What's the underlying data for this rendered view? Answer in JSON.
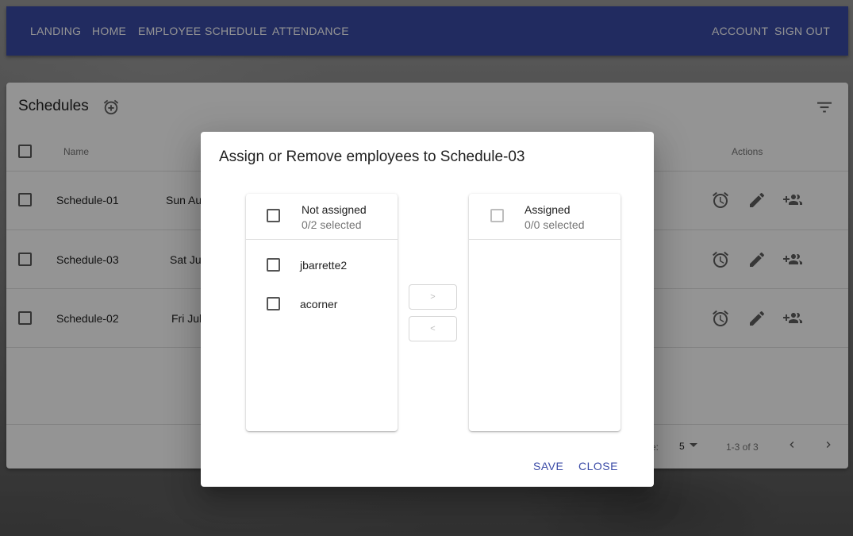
{
  "nav": {
    "left": [
      "LANDING",
      "HOME",
      "EMPLOYEE",
      "SCHEDULE",
      "ATTENDANCE"
    ],
    "right": [
      "ACCOUNT",
      "SIGN OUT"
    ]
  },
  "schedules": {
    "title": "Schedules",
    "columns": {
      "name": "Name",
      "actions": "Actions"
    },
    "rows": [
      {
        "name": "Schedule-01",
        "date": "Sun Au"
      },
      {
        "name": "Schedule-03",
        "date": "Sat Ju"
      },
      {
        "name": "Schedule-02",
        "date": "Fri Jul"
      }
    ],
    "footer": {
      "rows_label_tail": "e:",
      "rows_per_page": "5",
      "range": "1-3 of 3"
    }
  },
  "dialog": {
    "title": "Assign or Remove employees to Schedule-03",
    "left_list": {
      "title": "Not assigned",
      "subtitle": "0/2 selected",
      "items": [
        "jbarrette2",
        "acorner"
      ]
    },
    "right_list": {
      "title": "Assigned",
      "subtitle": "0/0 selected",
      "items": []
    },
    "move_right_label": ">",
    "move_left_label": "<",
    "save_label": "SAVE",
    "close_label": "CLOSE"
  },
  "colors": {
    "primary": "#3a4aa6",
    "scrim": "rgba(0,0,0,0.42)"
  },
  "icons": [
    "add-alarm-icon",
    "filter-icon",
    "alarm-icon",
    "edit-icon",
    "group-add-icon",
    "chevron-left-icon",
    "chevron-right-icon",
    "dropdown-arrow-icon"
  ]
}
